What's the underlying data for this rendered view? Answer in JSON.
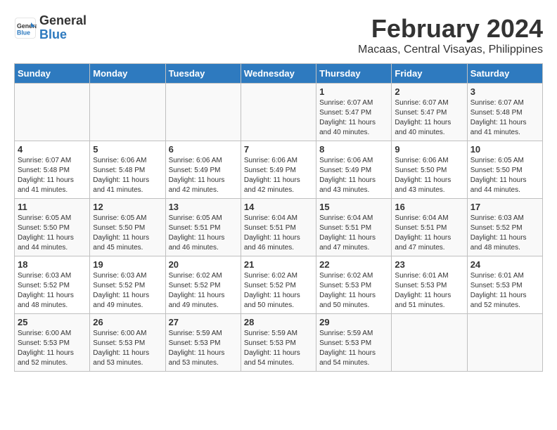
{
  "header": {
    "logo_line1": "General",
    "logo_line2": "Blue",
    "title": "February 2024",
    "subtitle": "Macaas, Central Visayas, Philippines"
  },
  "columns": [
    "Sunday",
    "Monday",
    "Tuesday",
    "Wednesday",
    "Thursday",
    "Friday",
    "Saturday"
  ],
  "weeks": [
    [
      {
        "day": "",
        "sunrise": "",
        "sunset": "",
        "daylight": ""
      },
      {
        "day": "",
        "sunrise": "",
        "sunset": "",
        "daylight": ""
      },
      {
        "day": "",
        "sunrise": "",
        "sunset": "",
        "daylight": ""
      },
      {
        "day": "",
        "sunrise": "",
        "sunset": "",
        "daylight": ""
      },
      {
        "day": "1",
        "sunrise": "Sunrise: 6:07 AM",
        "sunset": "Sunset: 5:47 PM",
        "daylight": "Daylight: 11 hours and 40 minutes."
      },
      {
        "day": "2",
        "sunrise": "Sunrise: 6:07 AM",
        "sunset": "Sunset: 5:47 PM",
        "daylight": "Daylight: 11 hours and 40 minutes."
      },
      {
        "day": "3",
        "sunrise": "Sunrise: 6:07 AM",
        "sunset": "Sunset: 5:48 PM",
        "daylight": "Daylight: 11 hours and 41 minutes."
      }
    ],
    [
      {
        "day": "4",
        "sunrise": "Sunrise: 6:07 AM",
        "sunset": "Sunset: 5:48 PM",
        "daylight": "Daylight: 11 hours and 41 minutes."
      },
      {
        "day": "5",
        "sunrise": "Sunrise: 6:06 AM",
        "sunset": "Sunset: 5:48 PM",
        "daylight": "Daylight: 11 hours and 41 minutes."
      },
      {
        "day": "6",
        "sunrise": "Sunrise: 6:06 AM",
        "sunset": "Sunset: 5:49 PM",
        "daylight": "Daylight: 11 hours and 42 minutes."
      },
      {
        "day": "7",
        "sunrise": "Sunrise: 6:06 AM",
        "sunset": "Sunset: 5:49 PM",
        "daylight": "Daylight: 11 hours and 42 minutes."
      },
      {
        "day": "8",
        "sunrise": "Sunrise: 6:06 AM",
        "sunset": "Sunset: 5:49 PM",
        "daylight": "Daylight: 11 hours and 43 minutes."
      },
      {
        "day": "9",
        "sunrise": "Sunrise: 6:06 AM",
        "sunset": "Sunset: 5:50 PM",
        "daylight": "Daylight: 11 hours and 43 minutes."
      },
      {
        "day": "10",
        "sunrise": "Sunrise: 6:05 AM",
        "sunset": "Sunset: 5:50 PM",
        "daylight": "Daylight: 11 hours and 44 minutes."
      }
    ],
    [
      {
        "day": "11",
        "sunrise": "Sunrise: 6:05 AM",
        "sunset": "Sunset: 5:50 PM",
        "daylight": "Daylight: 11 hours and 44 minutes."
      },
      {
        "day": "12",
        "sunrise": "Sunrise: 6:05 AM",
        "sunset": "Sunset: 5:50 PM",
        "daylight": "Daylight: 11 hours and 45 minutes."
      },
      {
        "day": "13",
        "sunrise": "Sunrise: 6:05 AM",
        "sunset": "Sunset: 5:51 PM",
        "daylight": "Daylight: 11 hours and 46 minutes."
      },
      {
        "day": "14",
        "sunrise": "Sunrise: 6:04 AM",
        "sunset": "Sunset: 5:51 PM",
        "daylight": "Daylight: 11 hours and 46 minutes."
      },
      {
        "day": "15",
        "sunrise": "Sunrise: 6:04 AM",
        "sunset": "Sunset: 5:51 PM",
        "daylight": "Daylight: 11 hours and 47 minutes."
      },
      {
        "day": "16",
        "sunrise": "Sunrise: 6:04 AM",
        "sunset": "Sunset: 5:51 PM",
        "daylight": "Daylight: 11 hours and 47 minutes."
      },
      {
        "day": "17",
        "sunrise": "Sunrise: 6:03 AM",
        "sunset": "Sunset: 5:52 PM",
        "daylight": "Daylight: 11 hours and 48 minutes."
      }
    ],
    [
      {
        "day": "18",
        "sunrise": "Sunrise: 6:03 AM",
        "sunset": "Sunset: 5:52 PM",
        "daylight": "Daylight: 11 hours and 48 minutes."
      },
      {
        "day": "19",
        "sunrise": "Sunrise: 6:03 AM",
        "sunset": "Sunset: 5:52 PM",
        "daylight": "Daylight: 11 hours and 49 minutes."
      },
      {
        "day": "20",
        "sunrise": "Sunrise: 6:02 AM",
        "sunset": "Sunset: 5:52 PM",
        "daylight": "Daylight: 11 hours and 49 minutes."
      },
      {
        "day": "21",
        "sunrise": "Sunrise: 6:02 AM",
        "sunset": "Sunset: 5:52 PM",
        "daylight": "Daylight: 11 hours and 50 minutes."
      },
      {
        "day": "22",
        "sunrise": "Sunrise: 6:02 AM",
        "sunset": "Sunset: 5:53 PM",
        "daylight": "Daylight: 11 hours and 50 minutes."
      },
      {
        "day": "23",
        "sunrise": "Sunrise: 6:01 AM",
        "sunset": "Sunset: 5:53 PM",
        "daylight": "Daylight: 11 hours and 51 minutes."
      },
      {
        "day": "24",
        "sunrise": "Sunrise: 6:01 AM",
        "sunset": "Sunset: 5:53 PM",
        "daylight": "Daylight: 11 hours and 52 minutes."
      }
    ],
    [
      {
        "day": "25",
        "sunrise": "Sunrise: 6:00 AM",
        "sunset": "Sunset: 5:53 PM",
        "daylight": "Daylight: 11 hours and 52 minutes."
      },
      {
        "day": "26",
        "sunrise": "Sunrise: 6:00 AM",
        "sunset": "Sunset: 5:53 PM",
        "daylight": "Daylight: 11 hours and 53 minutes."
      },
      {
        "day": "27",
        "sunrise": "Sunrise: 5:59 AM",
        "sunset": "Sunset: 5:53 PM",
        "daylight": "Daylight: 11 hours and 53 minutes."
      },
      {
        "day": "28",
        "sunrise": "Sunrise: 5:59 AM",
        "sunset": "Sunset: 5:53 PM",
        "daylight": "Daylight: 11 hours and 54 minutes."
      },
      {
        "day": "29",
        "sunrise": "Sunrise: 5:59 AM",
        "sunset": "Sunset: 5:53 PM",
        "daylight": "Daylight: 11 hours and 54 minutes."
      },
      {
        "day": "",
        "sunrise": "",
        "sunset": "",
        "daylight": ""
      },
      {
        "day": "",
        "sunrise": "",
        "sunset": "",
        "daylight": ""
      }
    ]
  ]
}
